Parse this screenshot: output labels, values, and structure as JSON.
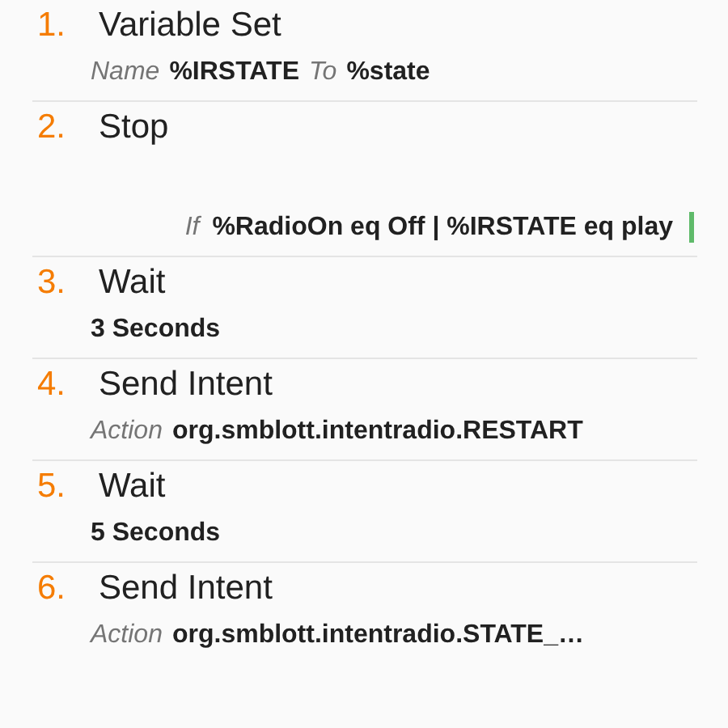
{
  "actions": [
    {
      "number": "1.",
      "title": "Variable Set",
      "params": [
        {
          "kind": "label",
          "text": "Name"
        },
        {
          "kind": "value",
          "text": "%IRSTATE"
        },
        {
          "kind": "label",
          "text": "To"
        },
        {
          "kind": "value",
          "text": "%state"
        }
      ]
    },
    {
      "number": "2.",
      "title": "Stop",
      "condition": {
        "label": "If",
        "text": "%RadioOn eq Off | %IRSTATE eq play"
      }
    },
    {
      "number": "3.",
      "title": "Wait",
      "params": [
        {
          "kind": "value",
          "text": "3 Seconds"
        }
      ]
    },
    {
      "number": "4.",
      "title": "Send Intent",
      "params": [
        {
          "kind": "label",
          "text": "Action"
        },
        {
          "kind": "value",
          "text": "org.smblott.intentradio.RESTART"
        }
      ]
    },
    {
      "number": "5.",
      "title": "Wait",
      "params": [
        {
          "kind": "value",
          "text": "5 Seconds"
        }
      ]
    },
    {
      "number": "6.",
      "title": "Send Intent",
      "params": [
        {
          "kind": "label",
          "text": "Action"
        },
        {
          "kind": "value",
          "text": "org.smblott.intentradio.STATE_…"
        }
      ]
    }
  ]
}
